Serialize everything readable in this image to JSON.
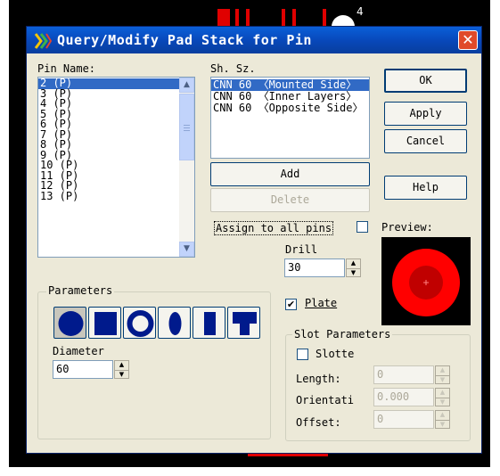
{
  "background": {
    "pcb_text": "4"
  },
  "dialog": {
    "title": "Query/Modify Pad Stack for Pin",
    "close_symbol": "✕",
    "pin_name_label": "Pin Name:",
    "pins": [
      "2 (P)",
      "3 (P)",
      "4 (P)",
      "5 (P)",
      "6 (P)",
      "7 (P)",
      "8 (P)",
      "9 (P)",
      "10 (P)",
      "11 (P)",
      "12 (P)",
      "13 (P)"
    ],
    "selected_pin": "2 (P)",
    "sh_sz_label": "Sh. Sz.",
    "layers": [
      "CNN 60 〈Mounted Side〉",
      "CNN 60 〈Inner Layers〉",
      "CNN 60 〈Opposite Side〉"
    ],
    "buttons": {
      "ok": "OK",
      "apply": "Apply",
      "cancel": "Cancel",
      "help": "Help",
      "add": "Add",
      "delete": "Delete"
    },
    "assign_all_pins_label": "Assign to all pins",
    "assign_all_pins_checked": false,
    "preview_label": "Preview:",
    "drill_label": "Drill",
    "drill_value": "30",
    "plate_label": "Plate",
    "plate_checked": true,
    "parameters": {
      "title": "Parameters",
      "shapes": [
        "round-shape",
        "square-shape",
        "annular-shape",
        "oval-shape",
        "rectangle-shape",
        "thermal-shape"
      ],
      "selected_shape": "round-shape",
      "diameter_label": "Diameter",
      "diameter_value": "60"
    },
    "slot_parameters": {
      "title": "Slot Parameters",
      "slotted_label": "Slotte",
      "slotted_checked": false,
      "length_label": "Length:",
      "length_value": "0",
      "orientation_label": "Orientati",
      "orientation_value": "0.000",
      "offset_label": "Offset:",
      "offset_value": "0"
    },
    "colors": {
      "title_bar": "#0a5fd8",
      "selection": "#316ac5",
      "pad_outer": "#ff0000",
      "pad_inner": "#c00000"
    }
  }
}
